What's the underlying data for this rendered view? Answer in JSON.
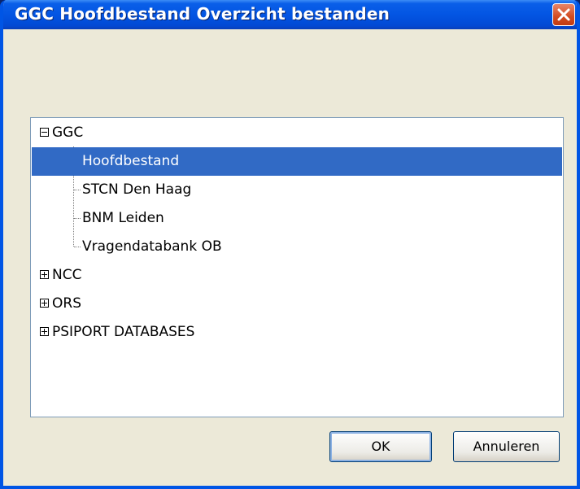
{
  "window": {
    "title": "GGC Hoofdbestand Overzicht bestanden"
  },
  "tree": {
    "groups": [
      {
        "label": "GGC",
        "expanded": true,
        "children": [
          {
            "label": "Hoofdbestand",
            "selected": true
          },
          {
            "label": "STCN Den Haag",
            "selected": false
          },
          {
            "label": "BNM Leiden",
            "selected": false
          },
          {
            "label": "Vragendatabank OB",
            "selected": false
          }
        ]
      },
      {
        "label": "NCC",
        "expanded": false,
        "children": []
      },
      {
        "label": "ORS",
        "expanded": false,
        "children": []
      },
      {
        "label": "PSIPORT DATABASES",
        "expanded": false,
        "children": []
      }
    ]
  },
  "buttons": {
    "ok_label": "OK",
    "cancel_label": "Annuleren"
  },
  "icons": {
    "close": "close-icon",
    "collapse": "minus-box-icon",
    "expand": "plus-box-icon"
  },
  "colors": {
    "selection": "#316ac5",
    "titlebar": "#0355e3",
    "dialog_bg": "#ece9d8"
  }
}
